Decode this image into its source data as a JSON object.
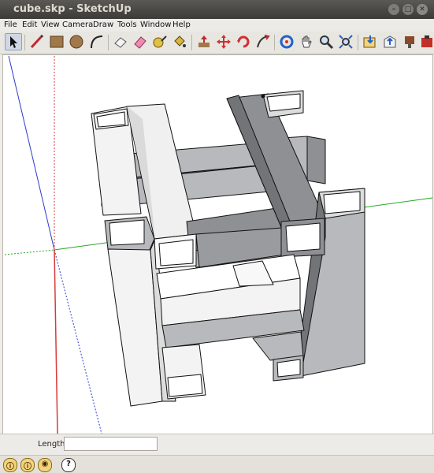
{
  "window": {
    "title": "cube.skp - SketchUp",
    "buttons": [
      "minimize",
      "maximize",
      "close"
    ]
  },
  "menubar": {
    "items": [
      "File",
      "Edit",
      "View",
      "Camera",
      "Draw",
      "Tools",
      "Window",
      "Help"
    ]
  },
  "toolbar": {
    "tools": [
      "select-arrow-icon",
      "pencil-line-icon",
      "rectangle-icon",
      "circle-icon",
      "arc-icon",
      "eraser-icon",
      "paint-bucket-icon",
      "push-pull-icon",
      "move-icon",
      "rotate-icon",
      "follow-me-icon",
      "offset-icon",
      "orbit-icon",
      "pan-icon",
      "zoom-icon",
      "zoom-extents-icon",
      "get-models-icon",
      "share-model-icon",
      "components-icon",
      "extension-warehouse-icon"
    ]
  },
  "measurements": {
    "label": "Length",
    "value": ""
  },
  "statusbar": {
    "icons": [
      "geolocation-icon",
      "credits-icon",
      "user-icon",
      "help-icon"
    ],
    "help_glyph": "?"
  },
  "colors": {
    "axis_red": "#d83a3a",
    "axis_green": "#25a825",
    "axis_blue": "#2a3ad0",
    "face_light": "#f3f3f3",
    "face_mid": "#b8b9bc",
    "face_dark": "#8f9094"
  }
}
